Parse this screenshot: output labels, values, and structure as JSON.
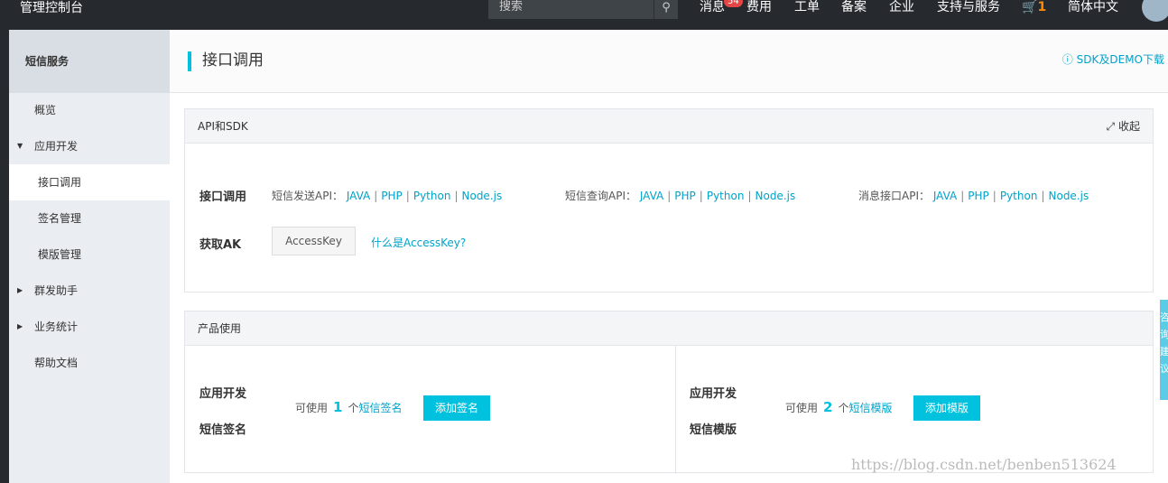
{
  "topbar": {
    "brand": "管理控制台",
    "search_placeholder": "搜索",
    "nav": [
      "消息",
      "费用",
      "工单",
      "备案",
      "企业",
      "支持与服务"
    ],
    "message_count": "54",
    "cart_count": "1",
    "language": "简体中文"
  },
  "sidebar": {
    "title": "短信服务",
    "items": [
      {
        "label": "概览",
        "type": "item"
      },
      {
        "label": "应用开发",
        "type": "group-open"
      },
      {
        "label": "接口调用",
        "type": "sub",
        "active": true
      },
      {
        "label": "签名管理",
        "type": "sub"
      },
      {
        "label": "模版管理",
        "type": "sub"
      },
      {
        "label": "群发助手",
        "type": "group"
      },
      {
        "label": "业务统计",
        "type": "group"
      },
      {
        "label": "帮助文档",
        "type": "item"
      }
    ]
  },
  "page": {
    "title": "接口调用",
    "sdk_link": "SDK及DEMO下载"
  },
  "api_panel": {
    "title": "API和SDK",
    "collapse": "收起",
    "row_label": "接口调用",
    "groups": [
      {
        "name": "短信发送API：",
        "links": [
          "JAVA",
          "PHP",
          "Python",
          "Node.js"
        ]
      },
      {
        "name": "短信查询API：",
        "links": [
          "JAVA",
          "PHP",
          "Python",
          "Node.js"
        ]
      },
      {
        "name": "消息接口API：",
        "links": [
          "JAVA",
          "PHP",
          "Python",
          "Node.js"
        ]
      }
    ],
    "ak_label": "获取AK",
    "ak_button": "AccessKey",
    "ak_help": "什么是AccessKey?"
  },
  "usage_panel": {
    "title": "产品使用",
    "left": {
      "label1": "应用开发",
      "label2": "短信签名",
      "prefix": "可使用",
      "count": "1",
      "unit": "个",
      "link": "短信签名",
      "button": "添加签名"
    },
    "right": {
      "label1": "应用开发",
      "label2": "短信模版",
      "prefix": "可使用",
      "count": "2",
      "unit": "个",
      "link": "短信模版",
      "button": "添加模版"
    }
  },
  "float_tab": "咨询建议",
  "watermark": "https://blog.csdn.net/benben513624",
  "colors": {
    "accent": "#00c1de",
    "topbar": "#262a2f",
    "badge": "#e54545"
  }
}
